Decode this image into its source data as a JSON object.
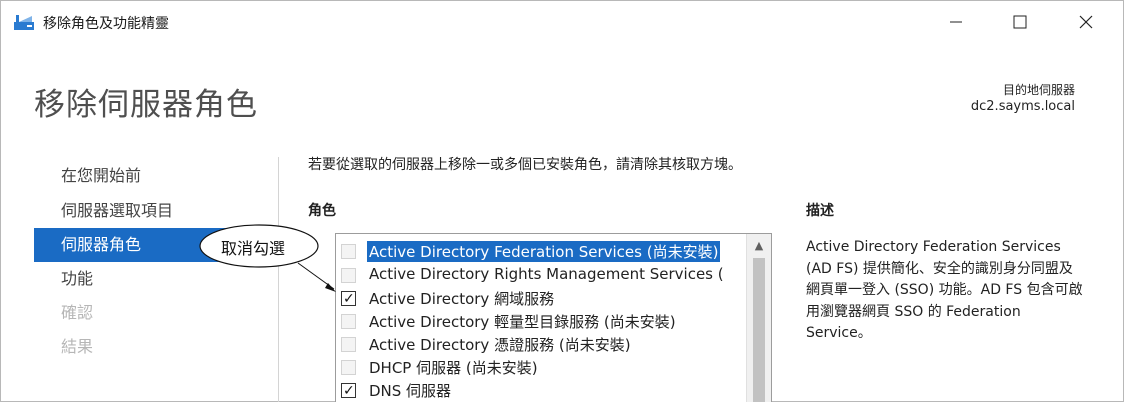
{
  "window": {
    "title": "移除角色及功能精靈",
    "controls": {
      "minimize": "–",
      "maximize": "☐",
      "close": "✕"
    }
  },
  "header": {
    "page_title": "移除伺服器角色",
    "destination_label": "目的地伺服器",
    "destination_server": "dc2.sayms.local"
  },
  "nav": {
    "items": [
      {
        "label": "在您開始前",
        "state": "normal"
      },
      {
        "label": "伺服器選取項目",
        "state": "normal"
      },
      {
        "label": "伺服器角色",
        "state": "active"
      },
      {
        "label": "功能",
        "state": "normal"
      },
      {
        "label": "確認",
        "state": "disabled"
      },
      {
        "label": "結果",
        "state": "disabled"
      }
    ]
  },
  "content": {
    "instruction": "若要從選取的伺服器上移除一或多個已安裝角色，請清除其核取方塊。",
    "roles_heading": "角色",
    "description_heading": "描述",
    "roles": [
      {
        "label": "Active Directory Federation Services (尚未安裝)",
        "checked": false,
        "enabled": false,
        "selected": true
      },
      {
        "label": "Active Directory Rights Management Services (",
        "checked": false,
        "enabled": false,
        "selected": false
      },
      {
        "label": "Active Directory 網域服務",
        "checked": true,
        "enabled": true,
        "selected": false
      },
      {
        "label": "Active Directory 輕量型目錄服務 (尚未安裝)",
        "checked": false,
        "enabled": false,
        "selected": false
      },
      {
        "label": "Active Directory 憑證服務 (尚未安裝)",
        "checked": false,
        "enabled": false,
        "selected": false
      },
      {
        "label": "DHCP 伺服器 (尚未安裝)",
        "checked": false,
        "enabled": false,
        "selected": false
      },
      {
        "label": "DNS 伺服器",
        "checked": true,
        "enabled": true,
        "selected": false
      }
    ],
    "description": "Active Directory Federation Services (AD FS) 提供簡化、安全的識別身分同盟及網頁單一登入 (SSO) 功能。AD FS 包含可啟用瀏覽器網頁 SSO 的 Federation Service。",
    "check_mark": "✓",
    "scroll_up_glyph": "▲"
  },
  "callout": {
    "text": "取消勾選"
  },
  "colors": {
    "accent": "#1a6bc4",
    "disabled_text": "#b6b6b6"
  }
}
